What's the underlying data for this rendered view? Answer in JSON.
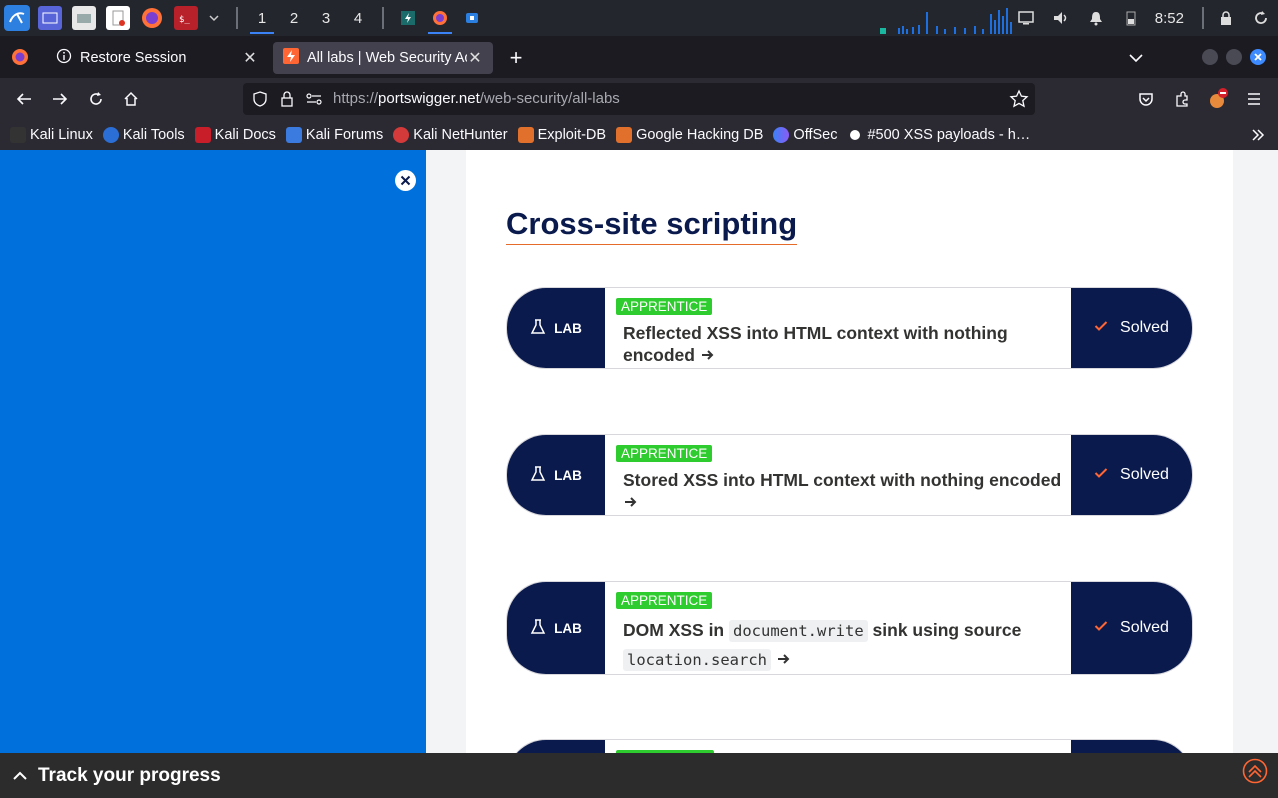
{
  "taskbar": {
    "workspaces": [
      "1",
      "2",
      "3",
      "4"
    ],
    "clock": "8:52"
  },
  "tabs": {
    "restore_label": "Restore Session",
    "active_label": "All labs | Web Security Academy"
  },
  "urlbar": {
    "scheme": "https://",
    "domain": "portswigger.net",
    "path": "/web-security/all-labs"
  },
  "bookmarks": [
    "Kali Linux",
    "Kali Tools",
    "Kali Docs",
    "Kali Forums",
    "Kali NetHunter",
    "Exploit-DB",
    "Google Hacking DB",
    "OffSec",
    "#500 XSS payloads - h…"
  ],
  "page": {
    "section_title": "Cross-site scripting",
    "lab_tag": "LAB",
    "level": "APPRENTICE",
    "status": "Solved",
    "labs": [
      {
        "title": "Reflected XSS into HTML context with nothing encoded"
      },
      {
        "title": "Stored XSS into HTML context with nothing encoded"
      },
      {
        "title_pre": "DOM XSS in",
        "code1": "document.write",
        "title_mid": "sink using source",
        "code2": "location.search"
      }
    ]
  },
  "track": {
    "label": "Track your progress"
  },
  "colors": {
    "sidebar": "#0071dc",
    "lab_dark": "#0a1a4d",
    "badge_green": "#2ecc2e",
    "title_underline": "#e56b2b"
  }
}
